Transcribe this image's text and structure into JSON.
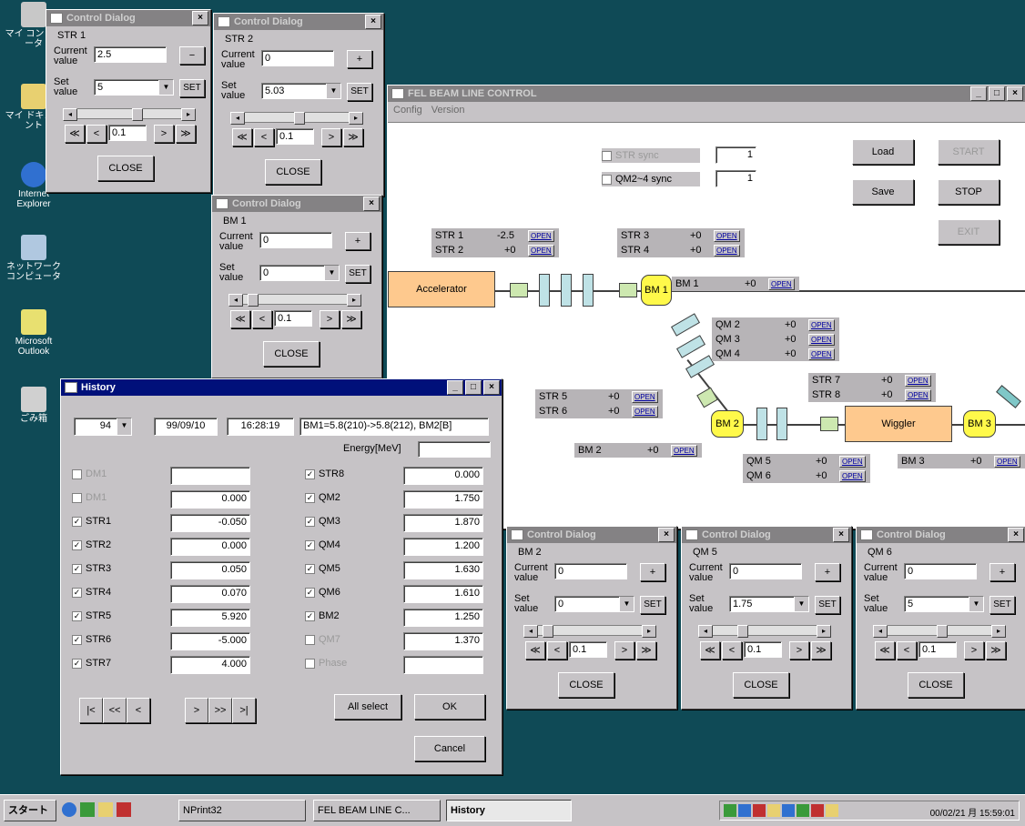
{
  "desktop": {
    "icons": [
      {
        "label": "マイ コンピュータ",
        "color": "#c8c8c8"
      },
      {
        "label": "マイ ドキュメント",
        "color": "#e8d070"
      },
      {
        "label": "Internet Explorer",
        "color": "#3070d0"
      },
      {
        "label": "ネットワーク コンピュータ",
        "color": "#b0c8e0"
      },
      {
        "label": "Microsoft Outlook",
        "color": "#e8e070"
      },
      {
        "label": "ごみ箱",
        "color": "#d0d0d0"
      }
    ]
  },
  "control_dialogs": [
    {
      "title": "Control Dialog",
      "name": "STR 1",
      "current": "2.5",
      "set": "5",
      "step": "0.1",
      "current_label": "Current value",
      "set_label": "Set value",
      "small_btn": "−",
      "set_btn": "SET",
      "close": "CLOSE",
      "thumb": 0.55
    },
    {
      "title": "Control Dialog",
      "name": "STR 2",
      "current": "0",
      "set": "5.03",
      "step": "0.1",
      "current_label": "Current value",
      "set_label": "Set value",
      "small_btn": "+",
      "set_btn": "SET",
      "close": "CLOSE",
      "thumb": 0.5
    },
    {
      "title": "Control Dialog",
      "name": "BM 1",
      "current": "0",
      "set": "0",
      "step": "0.1",
      "current_label": "Current value",
      "set_label": "Set value",
      "small_btn": "+",
      "set_btn": "SET",
      "close": "CLOSE",
      "thumb": 0.05
    },
    {
      "title": "Control Dialog",
      "name": "BM 2",
      "current": "0",
      "set": "0",
      "step": "0.1",
      "current_label": "Current value",
      "set_label": "Set value",
      "small_btn": "+",
      "set_btn": "SET",
      "close": "CLOSE",
      "thumb": 0.05
    },
    {
      "title": "Control Dialog",
      "name": "QM 5",
      "current": "0",
      "set": "1.75",
      "step": "0.1",
      "current_label": "Current value",
      "set_label": "Set value",
      "small_btn": "+",
      "set_btn": "SET",
      "close": "CLOSE",
      "thumb": 0.25
    },
    {
      "title": "Control Dialog",
      "name": "QM 6",
      "current": "0",
      "set": "5",
      "step": "0.1",
      "current_label": "Current value",
      "set_label": "Set value",
      "small_btn": "+",
      "set_btn": "SET",
      "close": "CLOSE",
      "thumb": 0.5
    }
  ],
  "nav_glyphs": {
    "first": "≪",
    "prev": "<",
    "next": ">",
    "last": "≫",
    "left": "◂",
    "right": "▸",
    "down": "▼"
  },
  "main": {
    "title": "FEL BEAM LINE CONTROL",
    "menu": [
      "Config",
      "Version"
    ],
    "sync1_label": "STR sync",
    "sync1_value": "1",
    "sync2_label": "QM2~4 sync",
    "sync2_value": "1",
    "buttons": {
      "load": "Load",
      "start": "START",
      "save": "Save",
      "stop": "STOP",
      "exit": "EXIT"
    },
    "open_label": "OPEN",
    "readouts": [
      {
        "name": "STR 1",
        "value": "-2.5"
      },
      {
        "name": "STR 2",
        "value": "+0"
      },
      {
        "name": "STR 3",
        "value": "+0"
      },
      {
        "name": "STR 4",
        "value": "+0"
      },
      {
        "name": "BM 1",
        "value": "+0"
      },
      {
        "name": "QM 2",
        "value": "+0"
      },
      {
        "name": "QM 3",
        "value": "+0"
      },
      {
        "name": "QM 4",
        "value": "+0"
      },
      {
        "name": "STR 7",
        "value": "+0"
      },
      {
        "name": "STR 8",
        "value": "+0"
      },
      {
        "name": "STR 5",
        "value": "+0"
      },
      {
        "name": "STR 6",
        "value": "+0"
      },
      {
        "name": "BM 2",
        "value": "+0"
      },
      {
        "name": "QM 5",
        "value": "+0"
      },
      {
        "name": "QM 6",
        "value": "+0"
      },
      {
        "name": "BM 3",
        "value": "+0"
      }
    ],
    "components": {
      "accelerator": "Accelerator",
      "bm1": "BM 1",
      "bm2": "BM 2",
      "wiggler": "Wiggler",
      "bm3": "BM 3"
    }
  },
  "history": {
    "title": "History",
    "record": "94",
    "date": "99/09/10",
    "time": "16:28:19",
    "change": "BM1=5.8(210)->5.8(212), BM2[B]",
    "energy_label": "Energy[MeV]",
    "energy_value": "",
    "left_rows": [
      {
        "label": "DM1",
        "value": "",
        "checked": false,
        "enabled": false
      },
      {
        "label": "DM1",
        "value": "0.000",
        "checked": false,
        "enabled": false
      },
      {
        "label": "STR1",
        "value": "-0.050",
        "checked": true,
        "enabled": true
      },
      {
        "label": "STR2",
        "value": "0.000",
        "checked": true,
        "enabled": true
      },
      {
        "label": "STR3",
        "value": "0.050",
        "checked": true,
        "enabled": true
      },
      {
        "label": "STR4",
        "value": "0.070",
        "checked": true,
        "enabled": true
      },
      {
        "label": "STR5",
        "value": "5.920",
        "checked": true,
        "enabled": true
      },
      {
        "label": "STR6",
        "value": "-5.000",
        "checked": true,
        "enabled": true
      },
      {
        "label": "STR7",
        "value": "4.000",
        "checked": true,
        "enabled": true
      }
    ],
    "right_rows": [
      {
        "label": "STR8",
        "value": "0.000",
        "checked": true,
        "enabled": true
      },
      {
        "label": "QM2",
        "value": "1.750",
        "checked": true,
        "enabled": true
      },
      {
        "label": "QM3",
        "value": "1.870",
        "checked": true,
        "enabled": true
      },
      {
        "label": "QM4",
        "value": "1.200",
        "checked": true,
        "enabled": true
      },
      {
        "label": "QM5",
        "value": "1.630",
        "checked": true,
        "enabled": true
      },
      {
        "label": "QM6",
        "value": "1.610",
        "checked": true,
        "enabled": true
      },
      {
        "label": "BM2",
        "value": "1.250",
        "checked": true,
        "enabled": true
      },
      {
        "label": "QM7",
        "value": "1.370",
        "checked": false,
        "enabled": false
      },
      {
        "label": "Phase",
        "value": "",
        "checked": false,
        "enabled": false
      }
    ],
    "nav": {
      "first": "|<",
      "prev2": "<<",
      "prev": "<",
      "next": ">",
      "next2": ">>",
      "last": ">|"
    },
    "all_select": "All select",
    "ok": "OK",
    "cancel": "Cancel"
  },
  "taskbar": {
    "start": "スタート",
    "items": [
      "NPrint32",
      "FEL BEAM LINE C...",
      "History"
    ],
    "clock": "00/02/21 月 15:59:01"
  }
}
